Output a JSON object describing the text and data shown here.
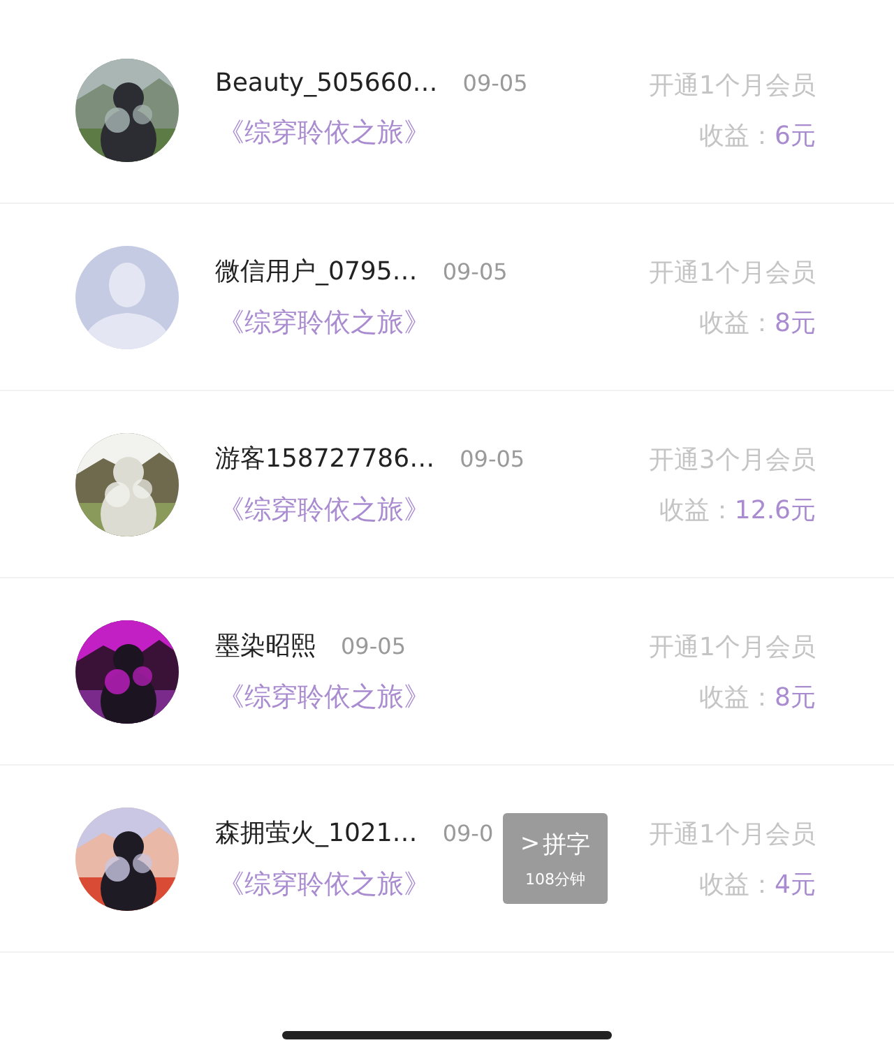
{
  "rows": [
    {
      "name": "Beauty_505660…",
      "date": "09-05",
      "book": "《综穿聆依之旅》",
      "plan": "开通1个月会员",
      "income_label": "收益：",
      "income": "6元"
    },
    {
      "avatar": {
        "kind": "default"
      },
      "name": "微信用户_0795…",
      "date": "09-05",
      "book": "《综穿聆依之旅》",
      "plan": "开通1个月会员",
      "income_label": "收益：",
      "income": "8元"
    },
    {
      "name": "游客158727786…",
      "date": "09-05",
      "book": "《综穿聆依之旅》",
      "plan": "开通3个月会员",
      "income_label": "收益：",
      "income": "12.6元"
    },
    {
      "name": "墨染昭熙",
      "date": "09-05",
      "book": "《综穿聆依之旅》",
      "plan": "开通1个月会员",
      "income_label": "收益：",
      "income": "8元"
    },
    {
      "name": "森拥萤火_1021…",
      "date": "09-0",
      "book": "《综穿聆依之旅》",
      "plan": "开通1个月会员",
      "income_label": "收益：",
      "income": "4元"
    }
  ],
  "floating_widget": {
    "icon": ">",
    "title": "拼字",
    "subtitle": "108分钟"
  }
}
